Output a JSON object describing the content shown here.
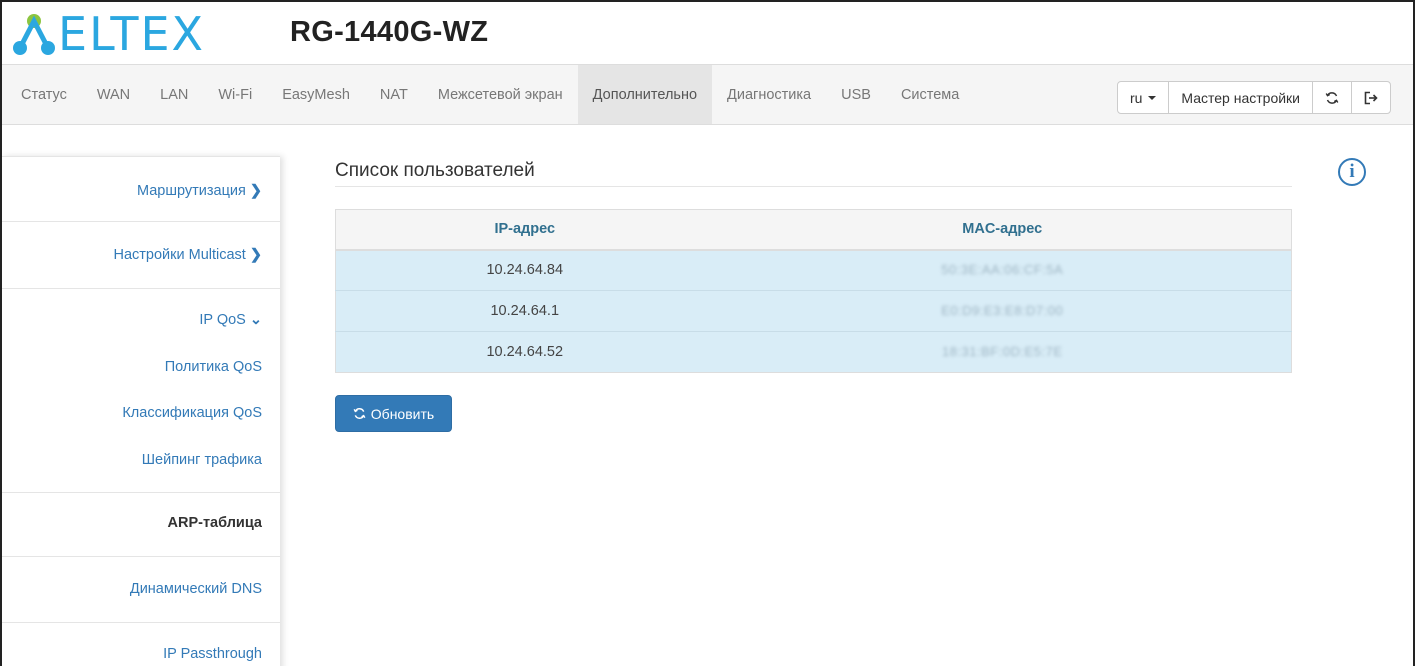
{
  "header": {
    "logo_text": "ELTEX",
    "model": "RG-1440G-WZ"
  },
  "nav": {
    "items": [
      "Статус",
      "WAN",
      "LAN",
      "Wi-Fi",
      "EasyMesh",
      "NAT",
      "Межсетевой экран",
      "Дополнительно",
      "Диагностика",
      "USB",
      "Система"
    ],
    "active": "Дополнительно",
    "lang_label": "ru",
    "wizard_label": "Мастер настройки",
    "refresh_icon": "refresh-icon",
    "logout_icon": "logout-icon"
  },
  "sidebar": {
    "items": [
      {
        "label": "Маршрутизация",
        "icon": "chevron-right-icon"
      },
      {
        "label": "Настройки Multicast",
        "icon": "chevron-right-icon"
      },
      {
        "label": "IP QoS",
        "icon": "chevron-down-icon"
      },
      {
        "label": "Политика QoS"
      },
      {
        "label": "Классификация QoS"
      },
      {
        "label": "Шейпинг трафика"
      },
      {
        "label": "ARP-таблица",
        "active": true
      },
      {
        "label": "Динамический DNS"
      },
      {
        "label": "IP Passthrough"
      }
    ]
  },
  "main": {
    "title": "Список пользователей",
    "table": {
      "columns": [
        "IP-адрес",
        "MAC-адрес"
      ],
      "rows": [
        [
          "10.24.64.84",
          "50:3E:AA:06:CF:5A"
        ],
        [
          "10.24.64.1",
          "E0:D9:E3:E8:D7:00"
        ],
        [
          "10.24.64.52",
          "18:31:BF:0D:E5:7E"
        ]
      ]
    },
    "refresh_button": "Обновить"
  },
  "colors": {
    "accent": "#337ab7",
    "logo": "#2ba7e0",
    "row_highlight": "#d9edf7"
  }
}
